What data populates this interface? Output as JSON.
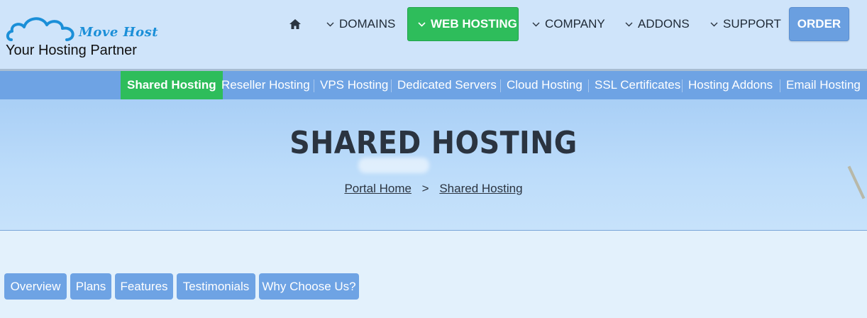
{
  "brand": {
    "name": "Move Host",
    "tagline": "Your Hosting Partner",
    "colors": {
      "cloud": "#1b8fd8",
      "accent": "#2ebd5b",
      "nav": "#6ea3e4"
    }
  },
  "nav": {
    "home_icon": "home-icon",
    "items": [
      {
        "label": "DOMAINS",
        "icon": "chevron-down-icon"
      },
      {
        "label": "WEB HOSTING",
        "icon": "chevron-down-icon",
        "active": true
      },
      {
        "label": "COMPANY",
        "icon": "chevron-down-icon"
      },
      {
        "label": "ADDONS",
        "icon": "chevron-down-icon"
      },
      {
        "label": "SUPPORT",
        "icon": "chevron-down-icon"
      }
    ],
    "order_label": "ORDER"
  },
  "subnav": {
    "items": [
      {
        "label": "Shared Hosting",
        "active": true
      },
      {
        "label": "Reseller Hosting"
      },
      {
        "label": "VPS Hosting"
      },
      {
        "label": "Dedicated Servers"
      },
      {
        "label": "Cloud Hosting"
      },
      {
        "label": "SSL Certificates"
      },
      {
        "label": "Hosting Addons"
      },
      {
        "label": "Email Hosting"
      }
    ]
  },
  "hero": {
    "title": "SHARED HOSTING",
    "breadcrumb": {
      "home": "Portal Home",
      "separator": ">",
      "current": "Shared Hosting"
    }
  },
  "section_tabs": [
    {
      "label": "Overview"
    },
    {
      "label": "Plans"
    },
    {
      "label": "Features"
    },
    {
      "label": "Testimonials"
    },
    {
      "label": "Why Choose Us?"
    }
  ]
}
